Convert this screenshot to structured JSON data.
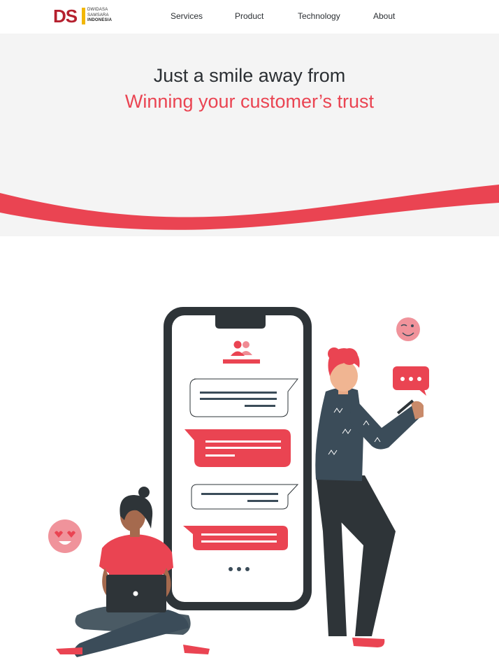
{
  "header": {
    "logo": {
      "mark": "DS",
      "mark_i": "I",
      "lines": [
        "DWIDASA",
        "SAMSARA",
        "INDONESIA"
      ]
    },
    "nav": [
      {
        "label": "Services"
      },
      {
        "label": "Product"
      },
      {
        "label": "Technology"
      },
      {
        "label": "About"
      }
    ]
  },
  "hero": {
    "line1": "Just a smile away from",
    "line2": "Winning your customer’s trust"
  },
  "colors": {
    "accent": "#ea4452",
    "dark": "#2b2f33",
    "hero_bg": "#f4f4f4",
    "logo_red": "#b5202e",
    "logo_yellow": "#f2b705"
  },
  "illustration": {
    "icons": [
      "phone-icon",
      "users-icon",
      "chat-bubble-icon",
      "heart-eyes-emoji-icon",
      "wink-emoji-icon",
      "woman-with-laptop",
      "man-with-phone"
    ]
  }
}
